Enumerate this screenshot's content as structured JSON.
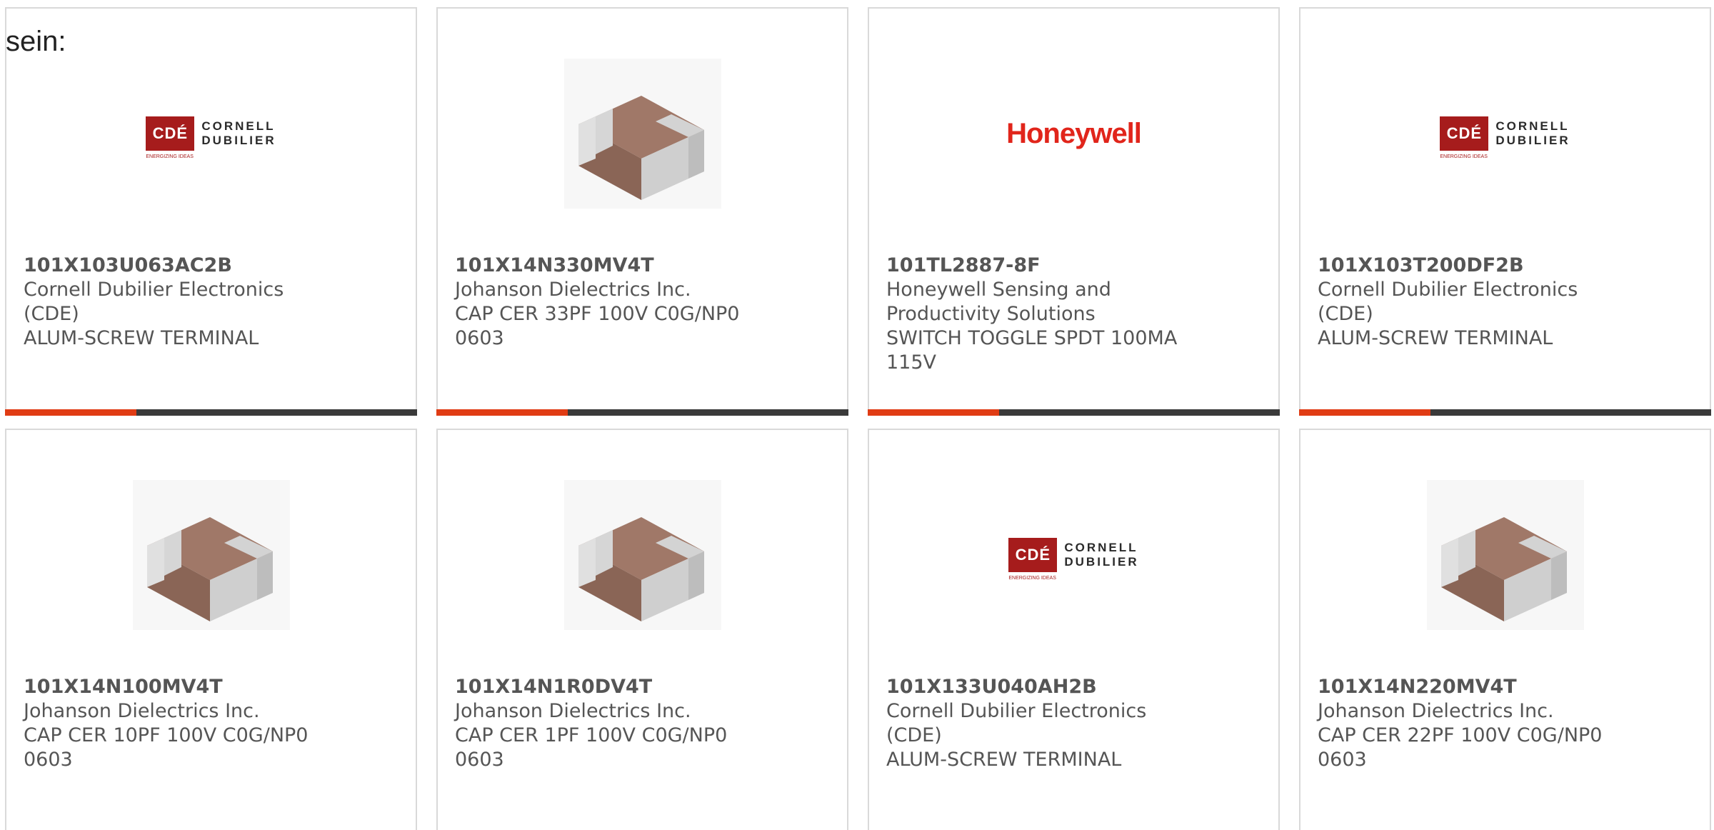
{
  "intro_text": "sein:",
  "colors": {
    "accent": "#e03c14",
    "bar": "#3a3a3a",
    "cde_red": "#a61c1c",
    "honeywell_red": "#e1251b",
    "text": "#555555"
  },
  "logos": {
    "cde": {
      "mark": "CDÉ",
      "line1": "CORNELL",
      "line2": "DUBILIER",
      "tagline": "ENERGIZING IDEAS"
    },
    "honeywell": {
      "name": "Honeywell"
    }
  },
  "products": [
    {
      "image": "cde-logo",
      "part_number": "101X103U063AC2B",
      "manufacturer": "Cornell Dubilier Electronics (CDE)",
      "description": "ALUM-SCREW TERMINAL"
    },
    {
      "image": "ceramic-chip-capacitor",
      "part_number": "101X14N330MV4T",
      "manufacturer": "Johanson Dielectrics Inc.",
      "description": "CAP CER 33PF 100V C0G/NP0 0603"
    },
    {
      "image": "honeywell-logo",
      "part_number": "101TL2887-8F",
      "manufacturer": "Honeywell Sensing and Productivity Solutions",
      "description": "SWITCH TOGGLE SPDT 100MA 115V"
    },
    {
      "image": "cde-logo",
      "part_number": "101X103T200DF2B",
      "manufacturer": "Cornell Dubilier Electronics (CDE)",
      "description": "ALUM-SCREW TERMINAL"
    },
    {
      "image": "ceramic-chip-capacitor",
      "part_number": "101X14N100MV4T",
      "manufacturer": "Johanson Dielectrics Inc.",
      "description": "CAP CER 10PF 100V C0G/NP0 0603"
    },
    {
      "image": "ceramic-chip-capacitor",
      "part_number": "101X14N1R0DV4T",
      "manufacturer": "Johanson Dielectrics Inc.",
      "description": "CAP CER 1PF 100V C0G/NP0 0603"
    },
    {
      "image": "cde-logo",
      "part_number": "101X133U040AH2B",
      "manufacturer": "Cornell Dubilier Electronics (CDE)",
      "description": "ALUM-SCREW TERMINAL"
    },
    {
      "image": "ceramic-chip-capacitor",
      "part_number": "101X14N220MV4T",
      "manufacturer": "Johanson Dielectrics Inc.",
      "description": "CAP CER 22PF 100V C0G/NP0 0603"
    }
  ]
}
